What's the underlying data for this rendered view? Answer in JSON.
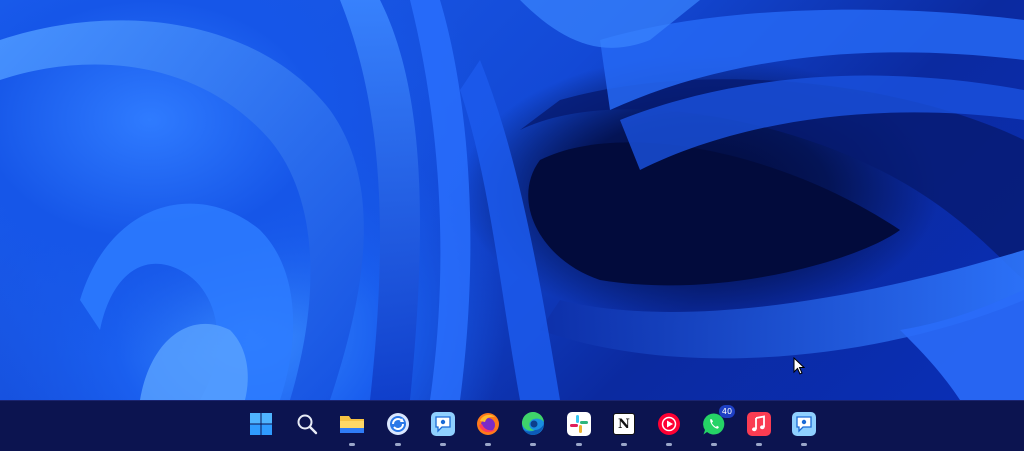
{
  "desktop": {
    "wallpaper": "windows-11-bloom-blue",
    "colors": {
      "light": "#2f7bff",
      "mid": "#1656e8",
      "dark": "#041456",
      "deep": "#020a3a"
    }
  },
  "taskbar": {
    "background": "#0c1450",
    "items": [
      {
        "name": "start-button",
        "icon": "windows-logo-icon",
        "running": false
      },
      {
        "name": "search-button",
        "icon": "search-icon",
        "running": false
      },
      {
        "name": "file-explorer",
        "icon": "folder-icon",
        "running": true
      },
      {
        "name": "sync-app",
        "icon": "sync-icon",
        "running": true
      },
      {
        "name": "chat-app-1",
        "icon": "speech-bubble-icon",
        "running": true
      },
      {
        "name": "firefox",
        "icon": "firefox-icon",
        "running": true
      },
      {
        "name": "edge",
        "icon": "edge-icon",
        "running": true
      },
      {
        "name": "slack",
        "icon": "slack-icon",
        "running": true
      },
      {
        "name": "notion",
        "icon": "notion-icon",
        "running": true,
        "label": "N"
      },
      {
        "name": "youtube-music",
        "icon": "play-icon",
        "running": true
      },
      {
        "name": "whatsapp",
        "icon": "whatsapp-icon",
        "running": true,
        "badge": "40"
      },
      {
        "name": "apple-music",
        "icon": "music-note-icon",
        "running": true
      },
      {
        "name": "chat-app-2",
        "icon": "speech-bubble-icon",
        "running": true
      }
    ]
  }
}
